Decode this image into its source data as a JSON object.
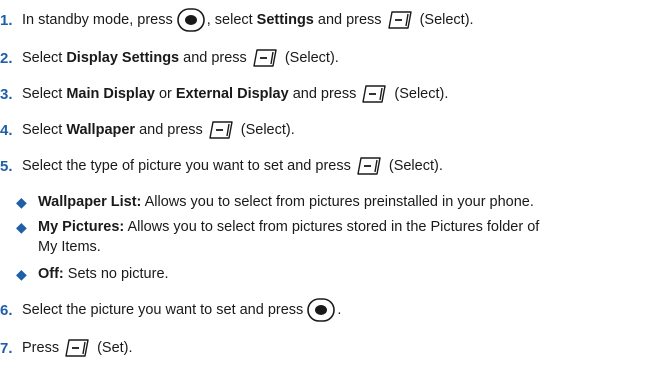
{
  "icons": {
    "ok_key": "ok-key-icon",
    "left_soft_key": "left-soft-key-icon",
    "bullet": "diamond-bullet-icon"
  },
  "colors": {
    "accent": "#1f5fa8",
    "text": "#1a1a1a"
  },
  "steps": [
    {
      "number": "1.",
      "parts": [
        "In standby mode, press",
        ", select",
        "Settings",
        "and press",
        "(Select)."
      ]
    },
    {
      "number": "2.",
      "parts": [
        "Select",
        "Display Settings",
        "and press",
        "(Select)."
      ]
    },
    {
      "number": "3.",
      "parts": [
        "Select",
        "Main Display",
        "or",
        "External Display",
        "and press",
        "(Select)."
      ]
    },
    {
      "number": "4.",
      "parts": [
        "Select",
        "Wallpaper",
        "and press",
        "(Select)."
      ]
    },
    {
      "number": "5.",
      "parts": [
        "Select the type of picture you want to set and press",
        "(Select)."
      ]
    },
    {
      "number": "6.",
      "parts": [
        "Select the picture you want to set and press",
        "."
      ]
    },
    {
      "number": "7.",
      "parts": [
        "Press",
        "(Set)."
      ]
    }
  ],
  "options": [
    {
      "title": "Wallpaper List:",
      "lines": [
        "Allows you to select from pictures preinstalled in your phone."
      ]
    },
    {
      "title": "My Pictures:",
      "lines": [
        "Allows you to select from pictures stored in the Pictures folder of",
        "My Items."
      ]
    },
    {
      "title": "Off:",
      "lines": [
        "Sets no picture."
      ]
    }
  ]
}
